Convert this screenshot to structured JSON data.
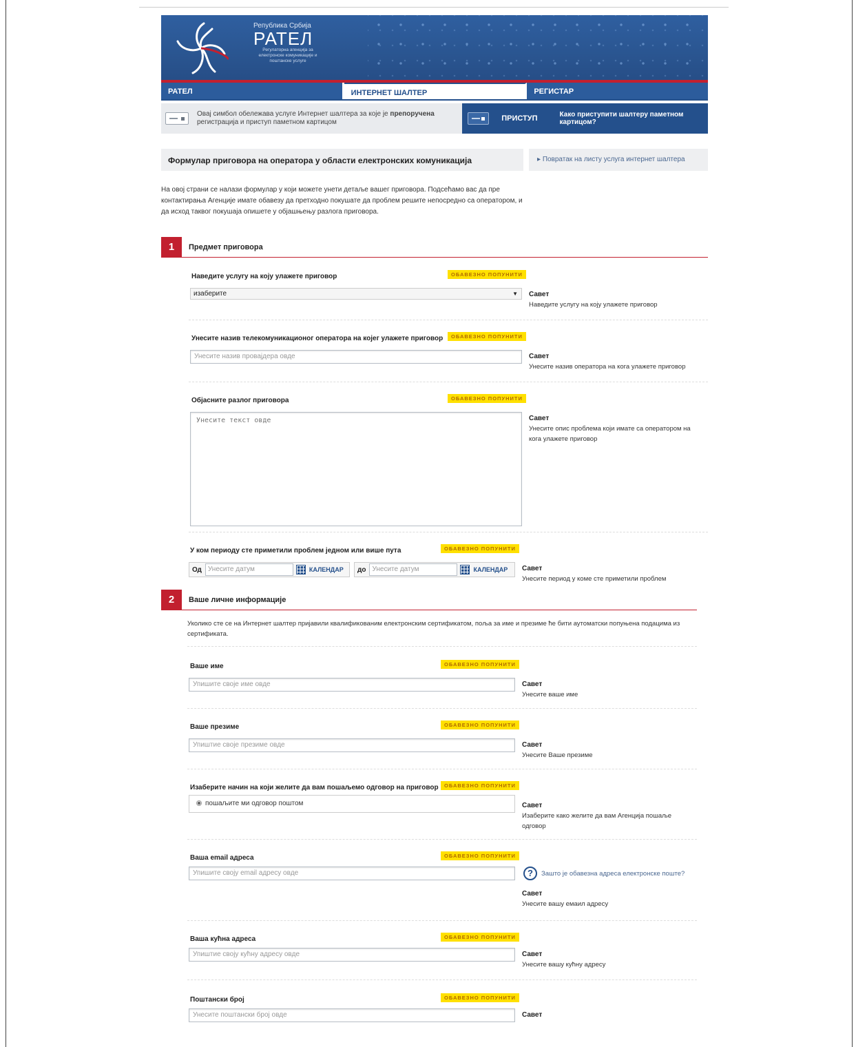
{
  "header": {
    "republic": "Република Србија",
    "brand": "РАТЕЛ",
    "brand_sub": "Регулаторна агенција за електронске комуникације и поштанске услуге"
  },
  "tabs": [
    {
      "label": "РАТЕЛ",
      "active": false
    },
    {
      "label": "ИНТЕРНЕТ ШАЛТЕР",
      "active": true
    },
    {
      "label": "РЕГИСТАР",
      "active": false
    }
  ],
  "strip": {
    "info_text_1": "Овај симбол обележава услуге Интернет шалтера за које је ",
    "info_bold": "препоручена",
    "info_text_2": "регистрација и приступ паметном картицом",
    "access_label": "ПРИСТУП",
    "howto_link": "Како приступити шалтеру паметном картицом?"
  },
  "page": {
    "title": "Формулар приговора на оператора у области електронских комуникација",
    "back_link": "Повратак на листу услуга интернет шалтера",
    "intro": "На овој страни се налази формулар у који можете унети детаље вашег приговора. Подсећамо вас да пре контактирања Агенције имате обавезу да претходно покушате да проблем решите непосредно са оператором, и да исход таквог покушаја опишете у објашњењу разлога приговора."
  },
  "required_label": "ОБАВЕЗНО ПОПУНИТИ",
  "advice_heading": "Савет",
  "section1": {
    "number": "1",
    "title": "Предмет приговора",
    "service_label": "Наведите услугу на коју улажете приговор",
    "service_value": "изаберите",
    "service_advice": "Наведите услугу на коју улажете приговор",
    "operator_label": "Унесите назив телекомуникационог оператора на којег улажете приговор",
    "operator_placeholder": "Унесите назив провајдера овде",
    "operator_advice": "Унесите назив оператора на кога улажете приговор",
    "reason_label": "Објасните разлог приговора",
    "reason_placeholder": "Унесите текст овде",
    "reason_advice": "Унесите опис проблема који имате са оператором на кога улажете приговор",
    "period_label": "У ком периоду сте приметили проблем једном или више пута",
    "from_label": "Од",
    "to_label": "до",
    "date_placeholder": "Унесите датум",
    "calendar_label": "КАЛЕНДАР",
    "period_advice": "Унесите период у коме сте приметили проблем"
  },
  "section2": {
    "number": "2",
    "title": "Ваше личне информације",
    "info": "Уколико сте се на Интернет шалтер пријавили квалификованим електронским сертификатом, поља за име и презиме ће бити аутоматски попуњена подацима из сертификата.",
    "first_name_label": "Ваше име",
    "first_name_placeholder": "Упишите своје име овде",
    "first_name_advice": "Унесите ваше име",
    "last_name_label": "Ваше презиме",
    "last_name_placeholder": "Упиштие своје презиме овде",
    "last_name_advice": "Унесите Ваше презиме",
    "reply_label": "Изаберите начин на који желите да вам пошаљемо одговор на приговор",
    "reply_option": "пошаљите ми одговор поштом",
    "reply_advice": "Изаберите како желите да вам Агенција пошаље одговор",
    "email_label": "Ваша email адреса",
    "email_placeholder": "Упишите своју email адресу овде",
    "email_help": "Зашто је обавезна адреса електронске поште?",
    "email_advice": "Унесите вашу емаил адресу",
    "address_label": "Ваша кућна адреса",
    "address_placeholder": "Упиштие своју кућну адресу овде",
    "address_advice": "Унесите вашу кућну адресу",
    "postal_label": "Поштански број",
    "postal_placeholder": "Унесите поштански број овде"
  }
}
